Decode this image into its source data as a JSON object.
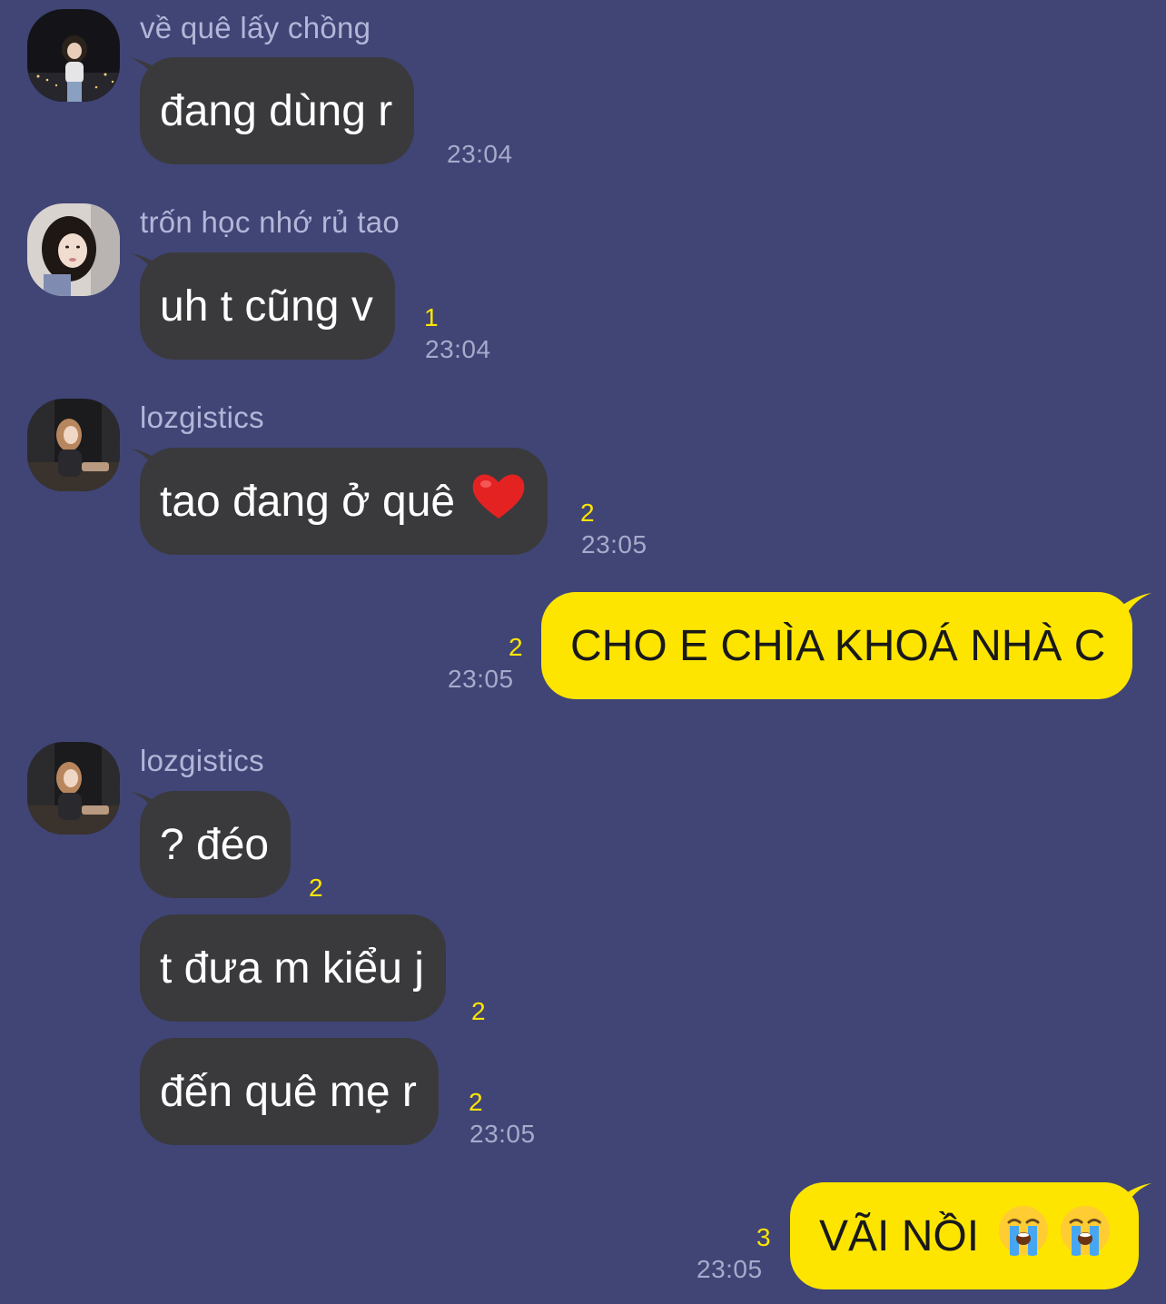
{
  "chat": {
    "messages": [
      {
        "sender": "về quê lấy chồng",
        "text": "đang dùng r",
        "time": "23:04"
      },
      {
        "sender": "trốn học nhớ rủ tao",
        "text": "uh t cũng v",
        "unread": "1",
        "time": "23:04"
      },
      {
        "sender": "lozgistics",
        "text": "tao đang ở quê",
        "emoji": "red-heart",
        "unread": "2",
        "time": "23:05"
      },
      {
        "text": "CHO E CHÌA KHOÁ NHÀ C",
        "unread": "2",
        "time": "23:05"
      },
      {
        "sender": "lozgistics",
        "text": "? đéo",
        "unread": "2"
      },
      {
        "text": "t đưa m kiểu j",
        "unread": "2"
      },
      {
        "text": "đến quê mẹ r",
        "unread": "2",
        "time": "23:05"
      },
      {
        "text": "VÃI NỒI",
        "emojis": [
          "loudly-crying-face",
          "loudly-crying-face"
        ],
        "unread": "3",
        "time": "23:05"
      }
    ]
  },
  "colors": {
    "background": "#404576",
    "incoming_bubble": "#3a3a3d",
    "outgoing_bubble": "#fee500",
    "unread_count": "#fee500",
    "timestamp": "#a7aacb"
  }
}
